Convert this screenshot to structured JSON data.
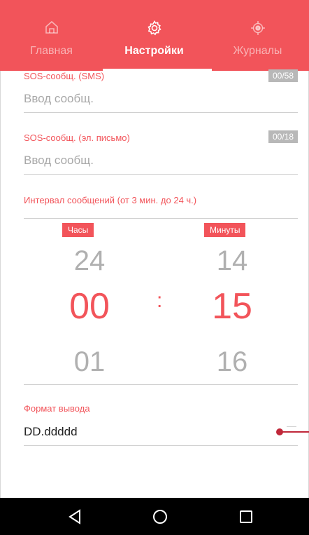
{
  "tabs": [
    {
      "label": "Главная",
      "icon": "home-icon"
    },
    {
      "label": "Настройки",
      "icon": "gear-icon"
    },
    {
      "label": "Журналы",
      "icon": "locate-icon"
    }
  ],
  "active_tab": "Настройки",
  "sos_sms": {
    "label": "SOS-сообщ. (SMS)",
    "counter": "00/58",
    "placeholder": "Ввод сообщ."
  },
  "sos_email": {
    "label": "SOS-сообщ. (эл. письмо)",
    "counter": "00/18",
    "placeholder": "Ввод сообщ."
  },
  "interval": {
    "label": "Интервал сообщений (от 3 мин. до 24 ч.)",
    "hours_label": "Часы",
    "minutes_label": "Минуты",
    "hours": {
      "prev": "24",
      "selected": "00",
      "next": "01"
    },
    "minutes": {
      "prev": "14",
      "selected": "15",
      "next": "16"
    },
    "separator": ":"
  },
  "format": {
    "label": "Формат вывода",
    "value": "DD.ddddd"
  },
  "navbar": {
    "back": "back-triangle-icon",
    "home": "home-circle-icon",
    "recents": "recents-square-icon"
  },
  "colors": {
    "accent": "#f2545a",
    "navbar": "#000000"
  }
}
